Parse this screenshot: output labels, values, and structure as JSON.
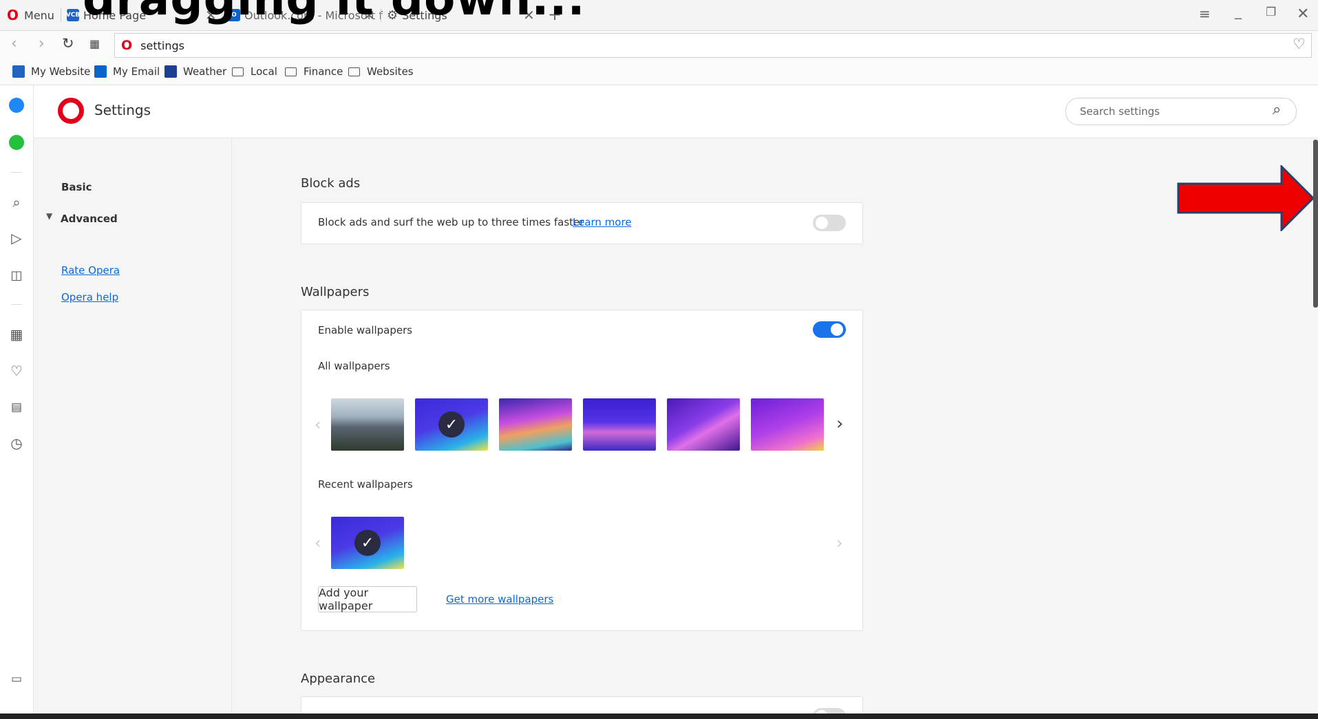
{
  "tabs": {
    "menu_label": "Menu",
    "home_tab": "Home Page",
    "outlook_tab": "Outlook.com - Microsoft f",
    "settings_tab": "Settings"
  },
  "overlay_caption": "dragging it down...",
  "address": {
    "url": "settings"
  },
  "bookmarks": [
    {
      "label": "My Website"
    },
    {
      "label": "My Email"
    },
    {
      "label": "Weather"
    },
    {
      "label": "Local"
    },
    {
      "label": "Finance"
    },
    {
      "label": "Websites"
    }
  ],
  "header": {
    "title": "Settings",
    "search_placeholder": "Search settings"
  },
  "nav": {
    "basic": "Basic",
    "advanced": "Advanced",
    "rate": "Rate Opera",
    "help": "Opera help"
  },
  "block_ads": {
    "title": "Block ads",
    "desc": "Block ads and surf the web up to three times faster",
    "learn_more": "Learn more",
    "enabled": false
  },
  "wallpapers": {
    "title": "Wallpapers",
    "enable_label": "Enable wallpapers",
    "enabled": true,
    "all_label": "All wallpapers",
    "recent_label": "Recent wallpapers",
    "add_button": "Add your wallpaper",
    "get_more": "Get more wallpapers"
  },
  "appearance": {
    "title": "Appearance"
  },
  "colors": {
    "accent": "#1a73e8",
    "link": "#0b6ad4",
    "arrow": "#ee0000"
  }
}
